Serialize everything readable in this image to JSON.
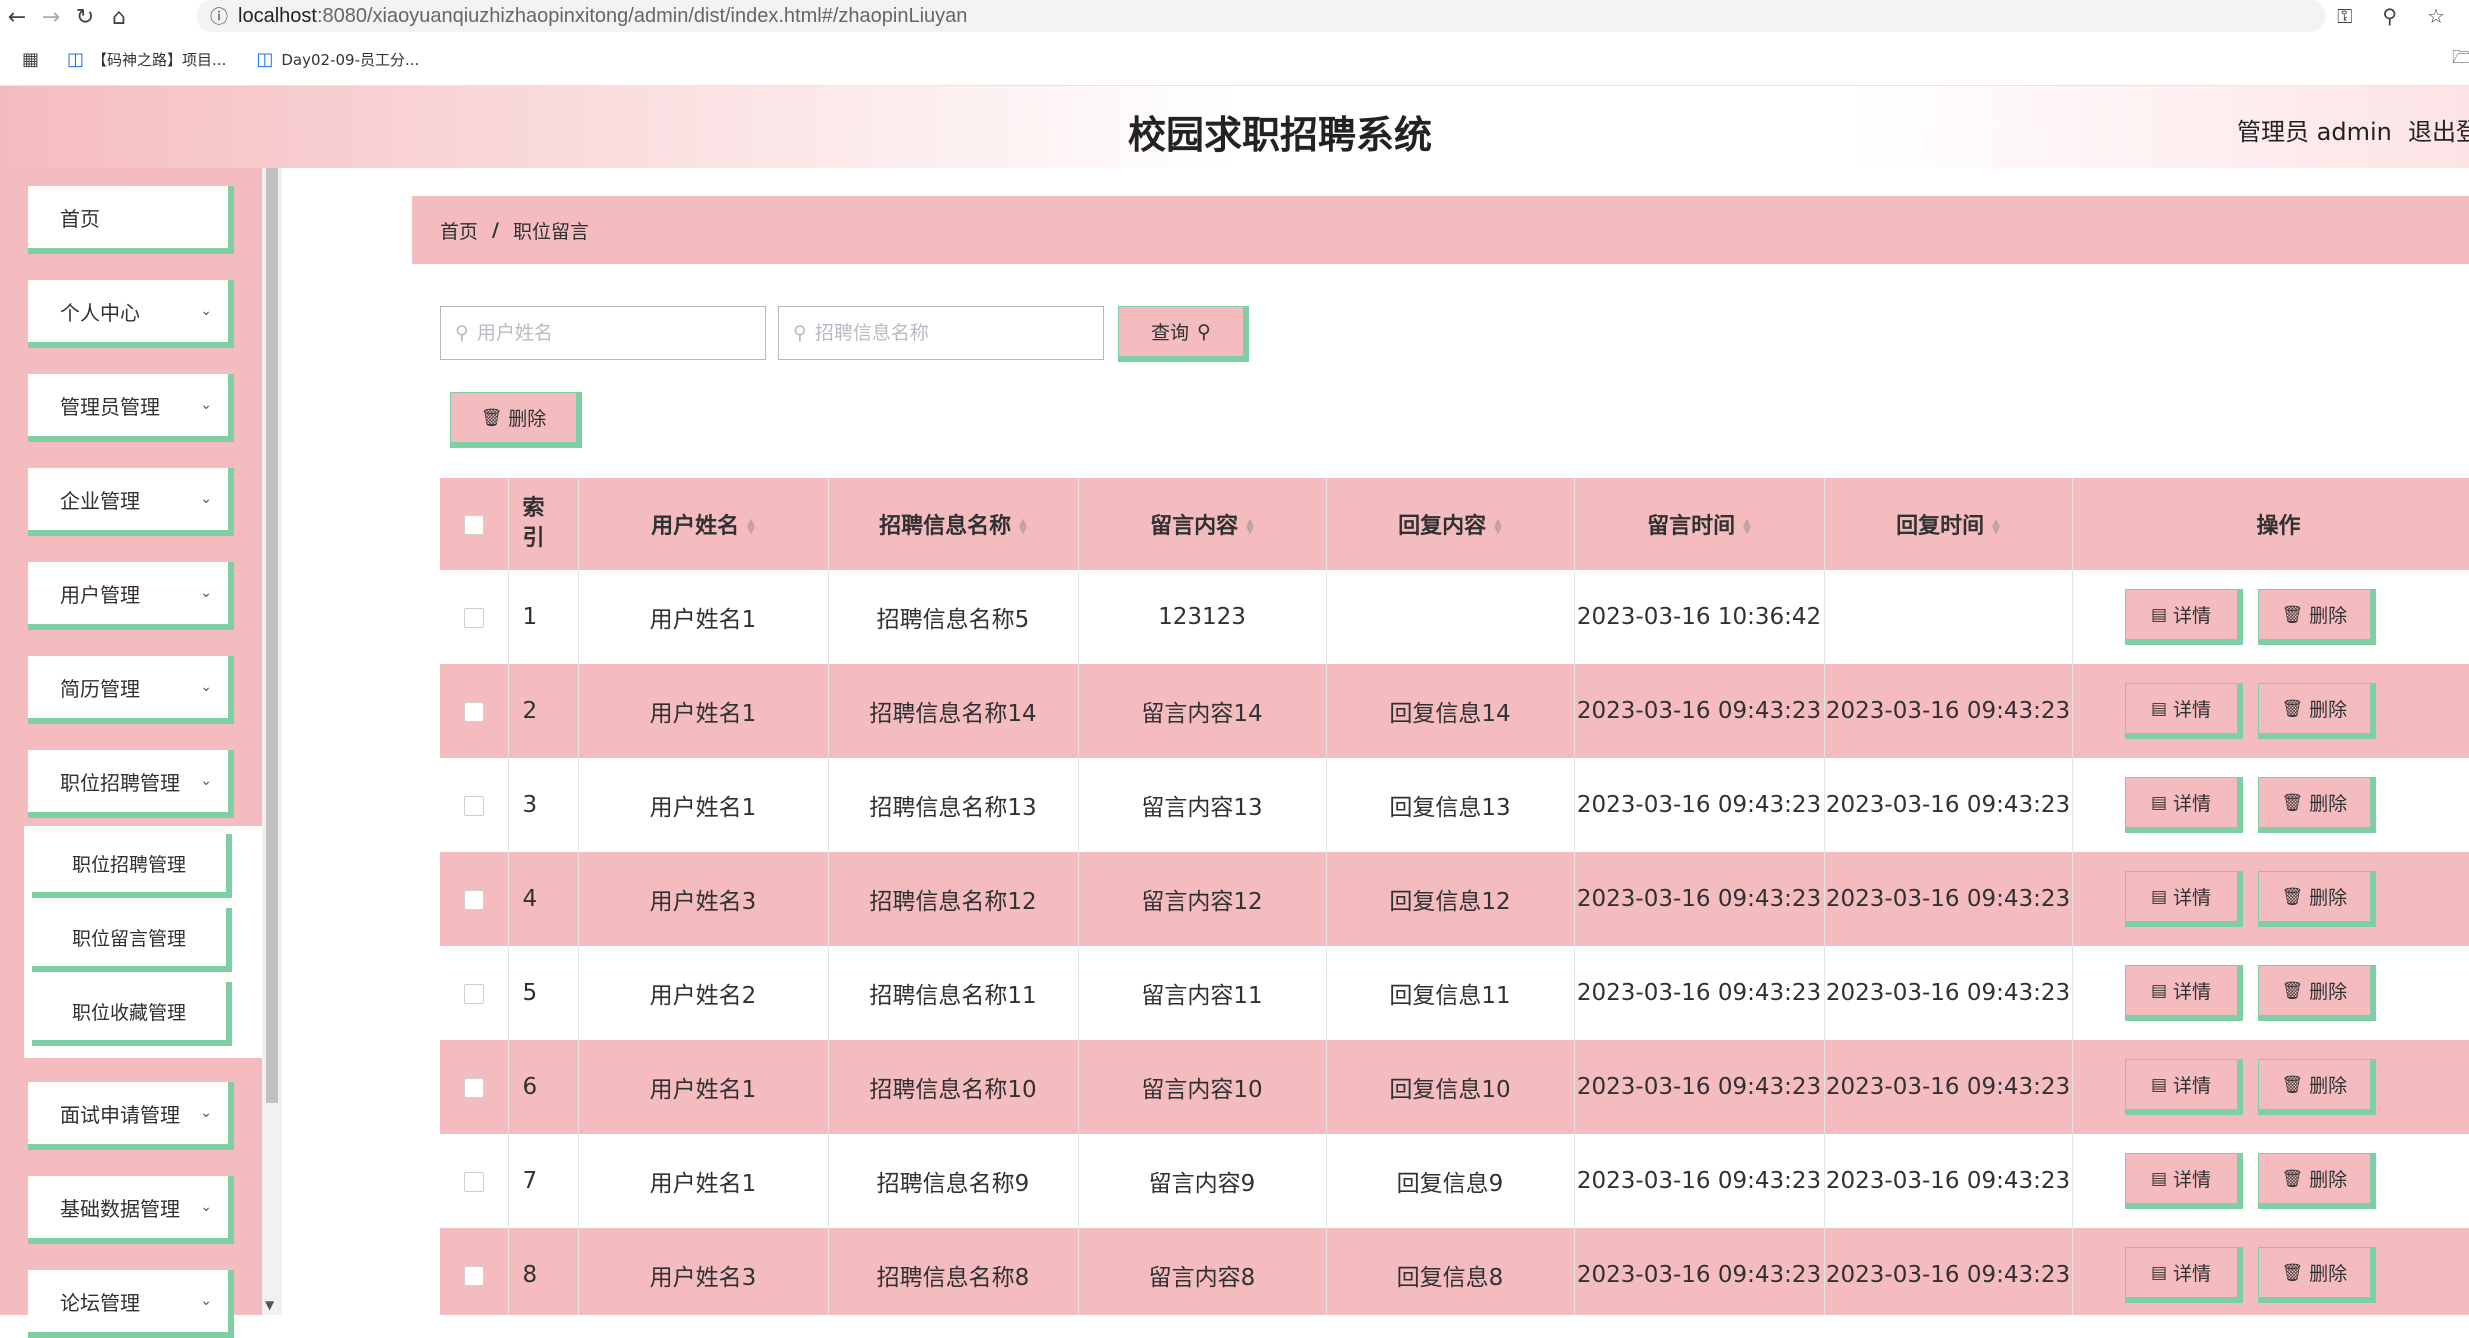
{
  "browser": {
    "url_host": "localhost",
    "url_rest": ":8080/xiaoyuanqiuzhizhaopinxitong/admin/dist/index.html#/zhaopinLiuyan",
    "bookmarks": [
      "【码神之路】项目...",
      "Day02-09-员工分..."
    ]
  },
  "header": {
    "title": "校园求职招聘系统",
    "admin_label": "管理员 admin",
    "logout_label": "退出登录"
  },
  "sidebar": {
    "items": [
      {
        "label": "首页"
      },
      {
        "label": "个人中心"
      },
      {
        "label": "管理员管理"
      },
      {
        "label": "企业管理"
      },
      {
        "label": "用户管理"
      },
      {
        "label": "简历管理"
      },
      {
        "label": "职位招聘管理"
      },
      {
        "label": "面试申请管理"
      },
      {
        "label": "基础数据管理"
      },
      {
        "label": "论坛管理"
      }
    ],
    "submenu": [
      {
        "label": "职位招聘管理"
      },
      {
        "label": "职位留言管理"
      },
      {
        "label": "职位收藏管理"
      }
    ]
  },
  "breadcrumb": {
    "home": "首页",
    "separator": "/",
    "current": "职位留言"
  },
  "search": {
    "user_placeholder": "用户姓名",
    "job_placeholder": "招聘信息名称",
    "query_label": "查询"
  },
  "toolbar": {
    "delete_label": "删除"
  },
  "table": {
    "headers": {
      "index": "索引",
      "user": "用户姓名",
      "job": "招聘信息名称",
      "content": "留言内容",
      "reply": "回复内容",
      "msg_time": "留言时间",
      "reply_time": "回复时间",
      "ops": "操作"
    },
    "detail_label": "详情",
    "delete_label": "删除",
    "rows": [
      {
        "index": "1",
        "user": "用户姓名1",
        "job": "招聘信息名称5",
        "content": "123123",
        "reply": "",
        "msg_time": "2023-03-16 10:36:42",
        "reply_time": ""
      },
      {
        "index": "2",
        "user": "用户姓名1",
        "job": "招聘信息名称14",
        "content": "留言内容14",
        "reply": "回复信息14",
        "msg_time": "2023-03-16 09:43:23",
        "reply_time": "2023-03-16 09:43:23"
      },
      {
        "index": "3",
        "user": "用户姓名1",
        "job": "招聘信息名称13",
        "content": "留言内容13",
        "reply": "回复信息13",
        "msg_time": "2023-03-16 09:43:23",
        "reply_time": "2023-03-16 09:43:23"
      },
      {
        "index": "4",
        "user": "用户姓名3",
        "job": "招聘信息名称12",
        "content": "留言内容12",
        "reply": "回复信息12",
        "msg_time": "2023-03-16 09:43:23",
        "reply_time": "2023-03-16 09:43:23"
      },
      {
        "index": "5",
        "user": "用户姓名2",
        "job": "招聘信息名称11",
        "content": "留言内容11",
        "reply": "回复信息11",
        "msg_time": "2023-03-16 09:43:23",
        "reply_time": "2023-03-16 09:43:23"
      },
      {
        "index": "6",
        "user": "用户姓名1",
        "job": "招聘信息名称10",
        "content": "留言内容10",
        "reply": "回复信息10",
        "msg_time": "2023-03-16 09:43:23",
        "reply_time": "2023-03-16 09:43:23"
      },
      {
        "index": "7",
        "user": "用户姓名1",
        "job": "招聘信息名称9",
        "content": "留言内容9",
        "reply": "回复信息9",
        "msg_time": "2023-03-16 09:43:23",
        "reply_time": "2023-03-16 09:43:23"
      },
      {
        "index": "8",
        "user": "用户姓名3",
        "job": "招聘信息名称8",
        "content": "留言内容8",
        "reply": "回复信息8",
        "msg_time": "2023-03-16 09:43:23",
        "reply_time": "2023-03-16 09:43:23"
      }
    ]
  },
  "colors": {
    "pink": "#f5bcbf",
    "green_accent": "#7fcfa4"
  }
}
